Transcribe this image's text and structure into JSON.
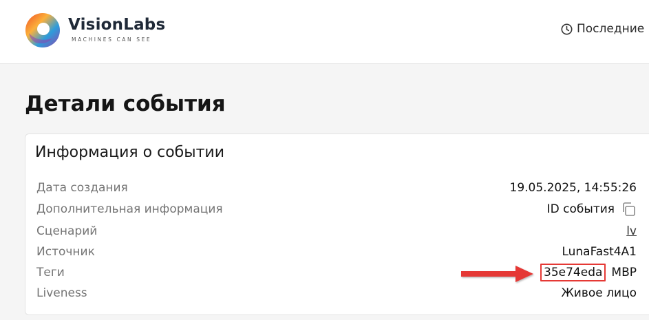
{
  "header": {
    "brand_name": "VisionLabs",
    "brand_tagline": "MACHINES CAN SEE",
    "nav_recent_label": "Последние",
    "nav_recent_icon": "clock-icon",
    "logo_colors": [
      "#f04e23",
      "#fbb03b",
      "#8e44ad",
      "#2d9cdb"
    ]
  },
  "page": {
    "title": "Детали события"
  },
  "event_info": {
    "title": "Информация о событии",
    "rows": [
      {
        "label": "Дата создания",
        "value": "19.05.2025, 14:55:26"
      },
      {
        "label": "Дополнительная информация",
        "value": "ID события",
        "icon": "copy-icon"
      },
      {
        "label": "Сценарий",
        "value": "lv"
      },
      {
        "label": "Источник",
        "value": "LunaFast4A1"
      },
      {
        "label": "Теги",
        "tags": [
          "35e74eda",
          "МВР"
        ]
      },
      {
        "label": "Liveness",
        "value": "Живое лицо"
      }
    ]
  },
  "annotation": {
    "color": "#e53935"
  }
}
